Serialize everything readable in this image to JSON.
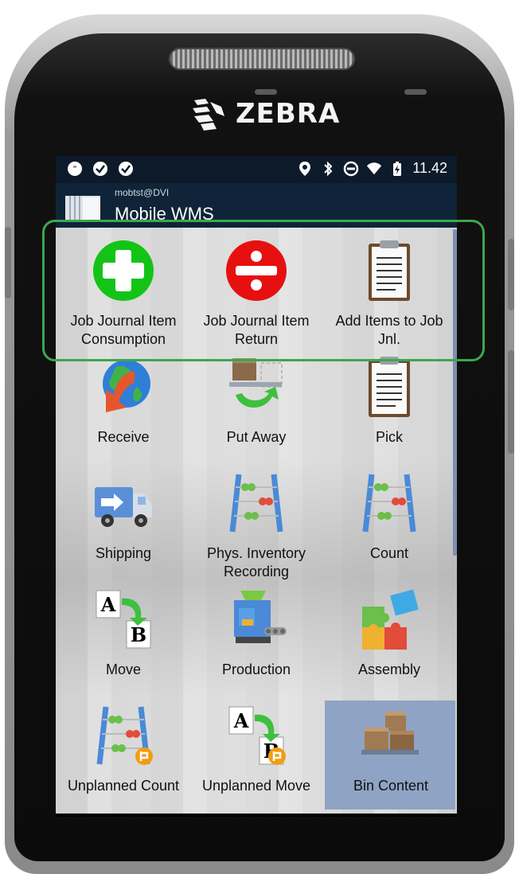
{
  "device": {
    "brand": "ZEBRA"
  },
  "status_bar": {
    "time": "11.42"
  },
  "app_bar": {
    "user": "mobtst@DVI",
    "title": "Mobile WMS"
  },
  "menu": [
    {
      "label": "Job Journal Item Consumption",
      "icon": "plus-icon"
    },
    {
      "label": "Job Journal Item Return",
      "icon": "divide-icon"
    },
    {
      "label": "Add Items to Job Jnl.",
      "icon": "clipboard-icon"
    },
    {
      "label": "Receive",
      "icon": "globe-arrow-icon"
    },
    {
      "label": "Put Away",
      "icon": "put-away-icon"
    },
    {
      "label": "Pick",
      "icon": "clipboard-icon"
    },
    {
      "label": "Shipping",
      "icon": "truck-icon"
    },
    {
      "label": "Phys. Inventory Recording",
      "icon": "abacus-icon"
    },
    {
      "label": "Count",
      "icon": "abacus-icon"
    },
    {
      "label": "Move",
      "icon": "move-a-b-icon"
    },
    {
      "label": "Production",
      "icon": "production-icon"
    },
    {
      "label": "Assembly",
      "icon": "puzzle-icon"
    },
    {
      "label": "Unplanned Count",
      "icon": "abacus-icon"
    },
    {
      "label": "Unplanned Move",
      "icon": "move-a-b-icon"
    },
    {
      "label": "Bin Content",
      "icon": "boxes-icon"
    }
  ],
  "selected_index": 14,
  "colors": {
    "highlight": "#3aa84d",
    "status_bg": "#0c1a2a",
    "selected_tile": "#8fa3c4"
  }
}
